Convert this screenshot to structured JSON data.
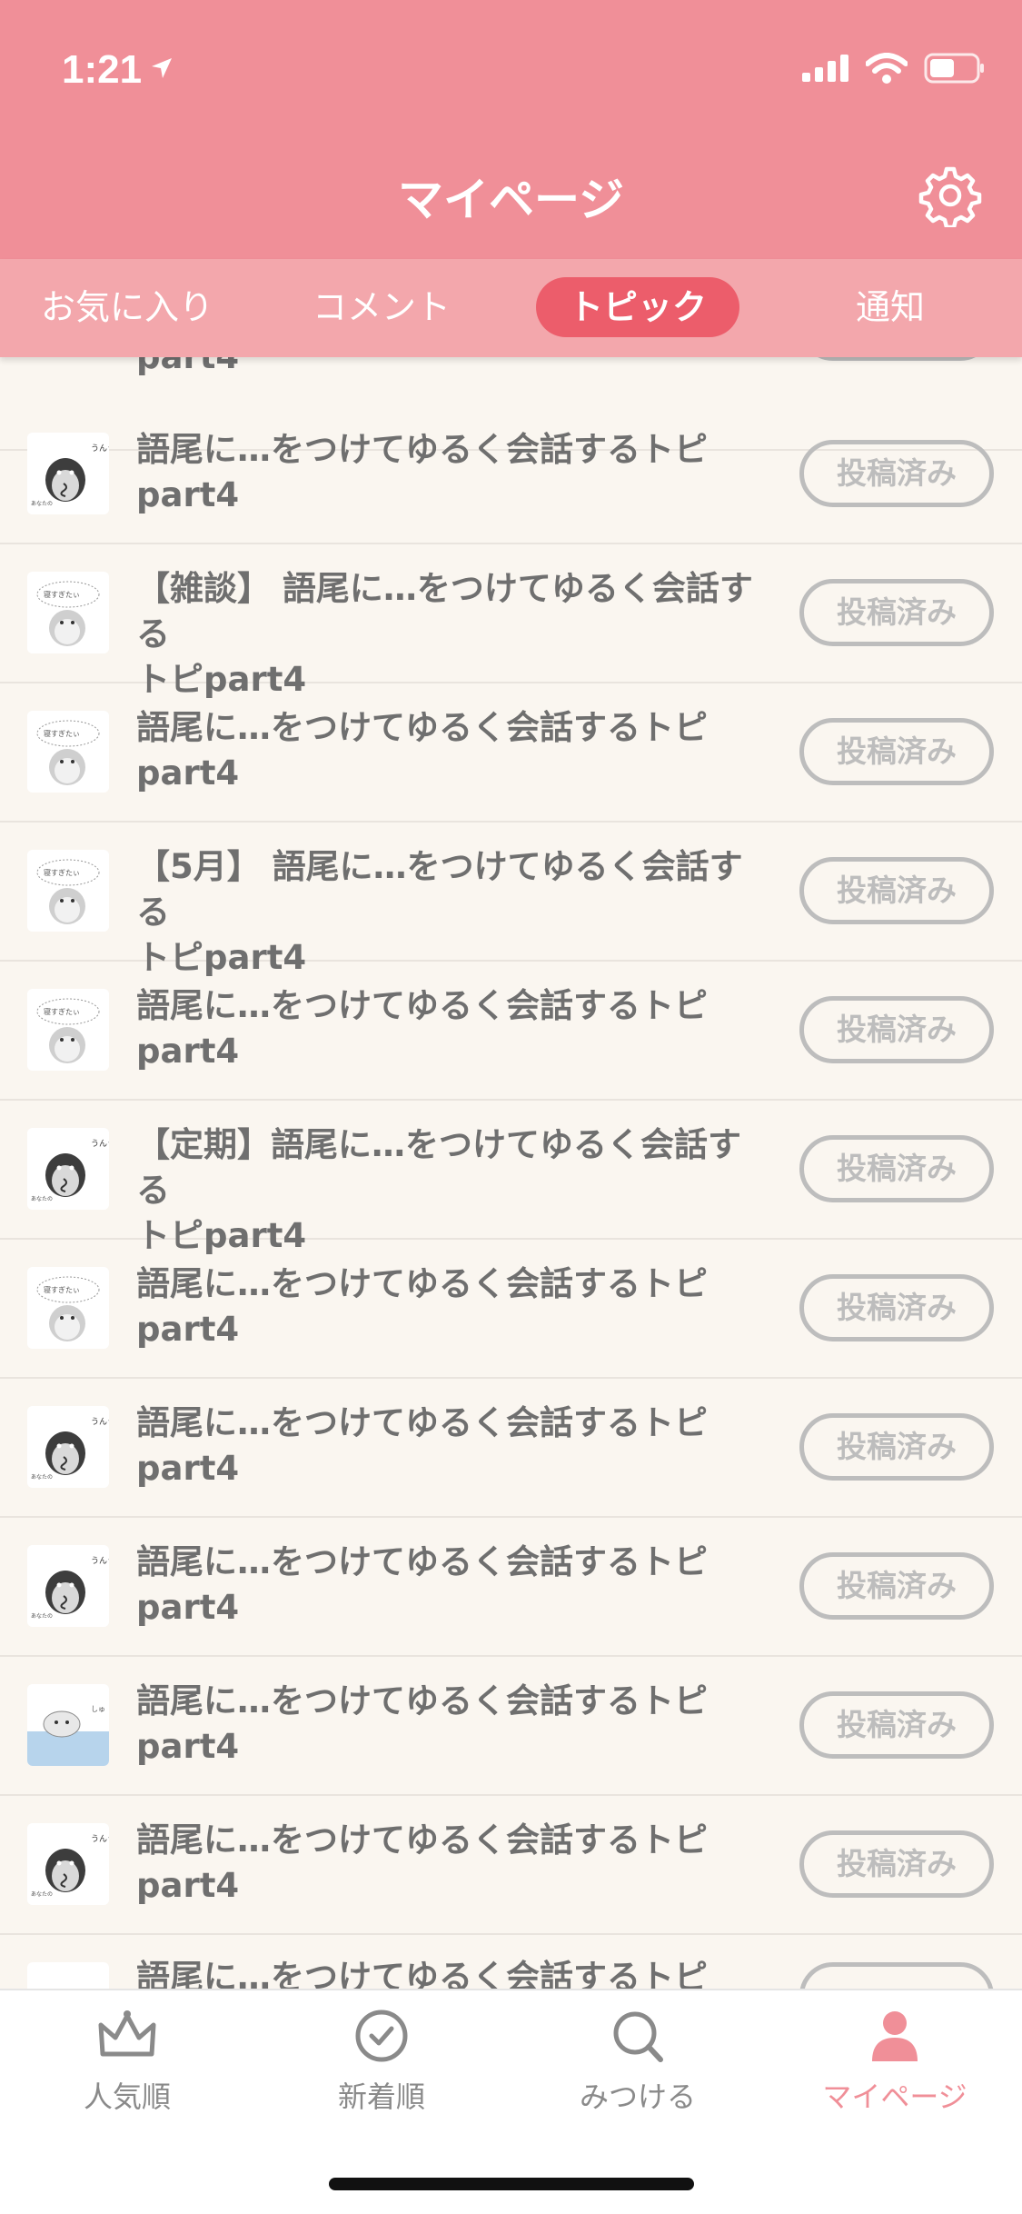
{
  "status_bar": {
    "time": "1:21"
  },
  "header": {
    "title": "マイページ",
    "settings_icon": "gear-icon"
  },
  "tabs": [
    {
      "label": "お気に入り",
      "active": false
    },
    {
      "label": "コメント",
      "active": false
    },
    {
      "label": "トピック",
      "active": true
    },
    {
      "label": "通知",
      "active": false
    }
  ],
  "partial_top_row": {
    "title": "part4"
  },
  "topics": [
    {
      "title": " 語尾に…をつけてゆるく会話するトピ\npart4",
      "status": "投稿済み",
      "thumb": "penguin-sign"
    },
    {
      "title": "【雑談】 語尾に…をつけてゆるく会話する\nトピpart4",
      "status": "投稿済み",
      "thumb": "penguin-thought"
    },
    {
      "title": " 語尾に…をつけてゆるく会話するトピ\npart4",
      "status": "投稿済み",
      "thumb": "penguin-thought"
    },
    {
      "title": "【5月】 語尾に…をつけてゆるく会話する\nトピpart4",
      "status": "投稿済み",
      "thumb": "penguin-thought"
    },
    {
      "title": " 語尾に…をつけてゆるく会話するトピ\npart4",
      "status": "投稿済み",
      "thumb": "penguin-thought"
    },
    {
      "title": "【定期】語尾に…をつけてゆるく会話する\nトピpart4",
      "status": "投稿済み",
      "thumb": "penguin-sign"
    },
    {
      "title": " 語尾に…をつけてゆるく会話するトピ\npart4",
      "status": "投稿済み",
      "thumb": "penguin-thought"
    },
    {
      "title": "語尾に…をつけてゆるく会話するトピ\npart4",
      "status": "投稿済み",
      "thumb": "penguin-sign"
    },
    {
      "title": "語尾に…をつけてゆるく会話するトピ\npart4",
      "status": "投稿済み",
      "thumb": "penguin-sign"
    },
    {
      "title": " 語尾に…をつけてゆるく会話するトピ\npart4",
      "status": "投稿済み",
      "thumb": "penguin-bath"
    },
    {
      "title": " 語尾に…をつけてゆるく会話するトピ\npart4",
      "status": "投稿済み",
      "thumb": "penguin-sign"
    }
  ],
  "partial_bottom_row": {
    "title": " 語尾に…をつけてゆるく会話するトピ"
  },
  "bottom_nav": [
    {
      "label": "人気順",
      "icon": "crown-icon",
      "active": false
    },
    {
      "label": "新着順",
      "icon": "clock-icon",
      "active": false
    },
    {
      "label": "みつける",
      "icon": "search-icon",
      "active": false
    },
    {
      "label": "マイページ",
      "icon": "person-icon",
      "active": true
    }
  ],
  "colors": {
    "header": "#f08f98",
    "tabbar": "#f3a7ac",
    "active_tab": "#ec5d6b",
    "background": "#faf6f0",
    "pill_border": "#bdbdbd"
  }
}
